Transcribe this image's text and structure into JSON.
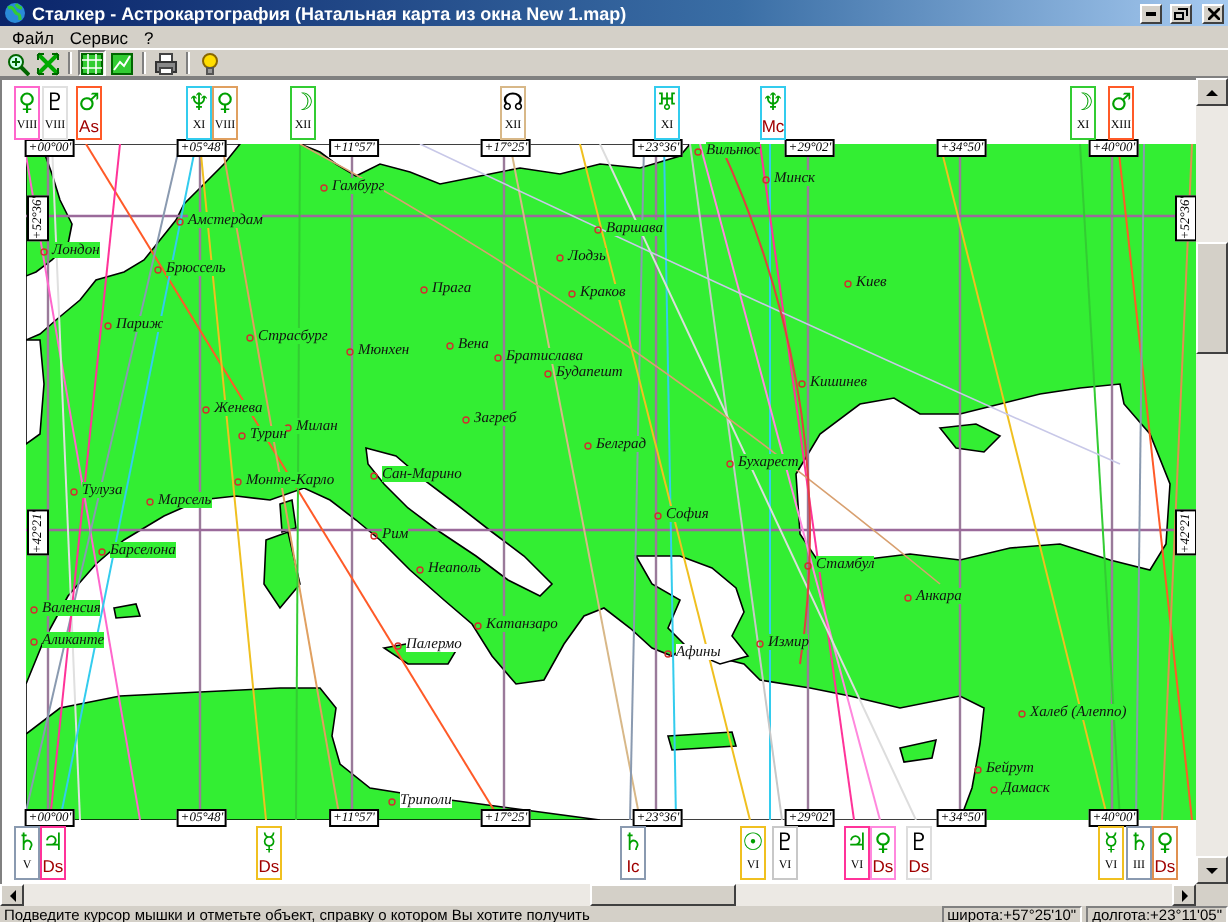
{
  "window": {
    "title": "Сталкер - Астрокартография (Натальная карта из окна New 1.map)"
  },
  "menu": [
    {
      "label": "Файл"
    },
    {
      "label": "Сервис"
    },
    {
      "label": "?"
    }
  ],
  "toolbar": [
    {
      "pressed": false
    },
    {
      "pressed": false
    },
    {
      "pressed": true
    },
    {
      "pressed": false
    },
    {
      "pressed": false
    },
    {
      "pressed": false
    }
  ],
  "map": {
    "longitude_labels_top": [
      "+00°00'",
      "+05°48'",
      "+11°57'",
      "+17°25'",
      "+23°36'",
      "+29°02'",
      "+34°50'",
      "+40°00'"
    ],
    "longitude_labels_bottom": [
      "+00°00'",
      "+05°48'",
      "+11°57'",
      "+17°25'",
      "+23°36'",
      "+29°02'",
      "+34°50'",
      "+40°00'"
    ],
    "latitude_labels_left": [
      "+52°36'",
      "+42°21'"
    ],
    "latitude_labels_right": [
      "+52°36'",
      "+42°21'"
    ],
    "cities": [
      {
        "name": "Вильнюс"
      },
      {
        "name": "Минск"
      },
      {
        "name": "Гамбург"
      },
      {
        "name": "Амстердам"
      },
      {
        "name": "Лондон"
      },
      {
        "name": "Брюссель"
      },
      {
        "name": "Варшава"
      },
      {
        "name": "Лодзь"
      },
      {
        "name": "Краков"
      },
      {
        "name": "Прага"
      },
      {
        "name": "Киев"
      },
      {
        "name": "Париж"
      },
      {
        "name": "Страсбург"
      },
      {
        "name": "Мюнхен"
      },
      {
        "name": "Вена"
      },
      {
        "name": "Братислава"
      },
      {
        "name": "Будапешт"
      },
      {
        "name": "Кишинев"
      },
      {
        "name": "Женева"
      },
      {
        "name": "Загреб"
      },
      {
        "name": "Турин"
      },
      {
        "name": "Милан"
      },
      {
        "name": "Белград"
      },
      {
        "name": "Бухарест"
      },
      {
        "name": "Сан-Марино"
      },
      {
        "name": "Монте-Карло"
      },
      {
        "name": "Тулуза"
      },
      {
        "name": "Марсель"
      },
      {
        "name": "София"
      },
      {
        "name": "Рим"
      },
      {
        "name": "Барселона"
      },
      {
        "name": "Стамбул"
      },
      {
        "name": "Неаполь"
      },
      {
        "name": "Анкара"
      },
      {
        "name": "Валенсия"
      },
      {
        "name": "Катанзаро"
      },
      {
        "name": "Аликанте"
      },
      {
        "name": "Палермо"
      },
      {
        "name": "Измир"
      },
      {
        "name": "Афины"
      },
      {
        "name": "Халеб (Алеппо)"
      },
      {
        "name": "Бейрут"
      },
      {
        "name": "Дамаск"
      },
      {
        "name": "Триполи"
      }
    ],
    "top_markers": [
      {
        "glyph": "♀",
        "house": "VIII",
        "kind": "planet",
        "angle": false,
        "color": "#ff66cc"
      },
      {
        "glyph": "♇",
        "house": "VIII",
        "kind": "point",
        "angle": false,
        "color": "#e0e0e0"
      },
      {
        "glyph": "♂",
        "house": "As",
        "kind": "planet",
        "angle": true,
        "color": "#ff5a28"
      },
      {
        "glyph": "♆",
        "house": "XI",
        "kind": "planet",
        "angle": false,
        "color": "#33ccee"
      },
      {
        "glyph": "♀",
        "house": "VIII",
        "kind": "planet",
        "angle": false,
        "color": "#e0a060"
      },
      {
        "glyph": "☽",
        "house": "XII",
        "kind": "planet",
        "angle": false,
        "color": "#33cc33"
      },
      {
        "glyph": "☊",
        "house": "XII",
        "kind": "point",
        "angle": false,
        "color": "#d8b888"
      },
      {
        "glyph": "♅",
        "house": "XI",
        "kind": "planet",
        "angle": false,
        "color": "#33ccee"
      },
      {
        "glyph": "♆",
        "house": "Mc",
        "kind": "planet",
        "angle": true,
        "color": "#33ccee"
      },
      {
        "glyph": "☽",
        "house": "XI",
        "kind": "planet",
        "angle": false,
        "color": "#33cc33"
      },
      {
        "glyph": "♂",
        "house": "XIII",
        "kind": "planet",
        "angle": false,
        "color": "#ff5a28"
      }
    ],
    "bottom_markers": [
      {
        "glyph": "♄",
        "house": "V",
        "kind": "planet",
        "angle": false,
        "color": "#8a9ab0"
      },
      {
        "glyph": "♃",
        "house": "Ds",
        "kind": "planet",
        "angle": true,
        "color": "#ff3399"
      },
      {
        "glyph": "☿",
        "house": "Ds",
        "kind": "planet",
        "angle": true,
        "color": "#f0c020"
      },
      {
        "glyph": "♄",
        "house": "Ic",
        "kind": "planet",
        "angle": true,
        "color": "#8a9ab0"
      },
      {
        "glyph": "☉",
        "house": "VI",
        "kind": "planet",
        "angle": false,
        "color": "#f0c020"
      },
      {
        "glyph": "♇",
        "house": "VI",
        "kind": "point",
        "angle": false,
        "color": "#c8c8c8"
      },
      {
        "glyph": "♃",
        "house": "VI",
        "kind": "planet",
        "angle": false,
        "color": "#ff3399"
      },
      {
        "glyph": "♀",
        "house": "Ds",
        "kind": "planet",
        "angle": true,
        "color": "#ff88dd"
      },
      {
        "glyph": "♇",
        "house": "Ds",
        "kind": "point",
        "angle": true,
        "color": "#dddddd"
      },
      {
        "glyph": "☿",
        "house": "VI",
        "kind": "planet",
        "angle": false,
        "color": "#f0c020"
      },
      {
        "glyph": "♄",
        "house": "III",
        "kind": "planet",
        "angle": false,
        "color": "#8a9ab0"
      },
      {
        "glyph": "♀",
        "house": "Ds",
        "kind": "planet",
        "angle": true,
        "color": "#e09050"
      }
    ]
  },
  "status_bar": {
    "hint": "Подведите курсор мышки и отметьте объект, справку о котором Вы хотите получить",
    "latitude": "широта:+57°25'10\"",
    "longitude": "долгота:+23°11'05\""
  }
}
